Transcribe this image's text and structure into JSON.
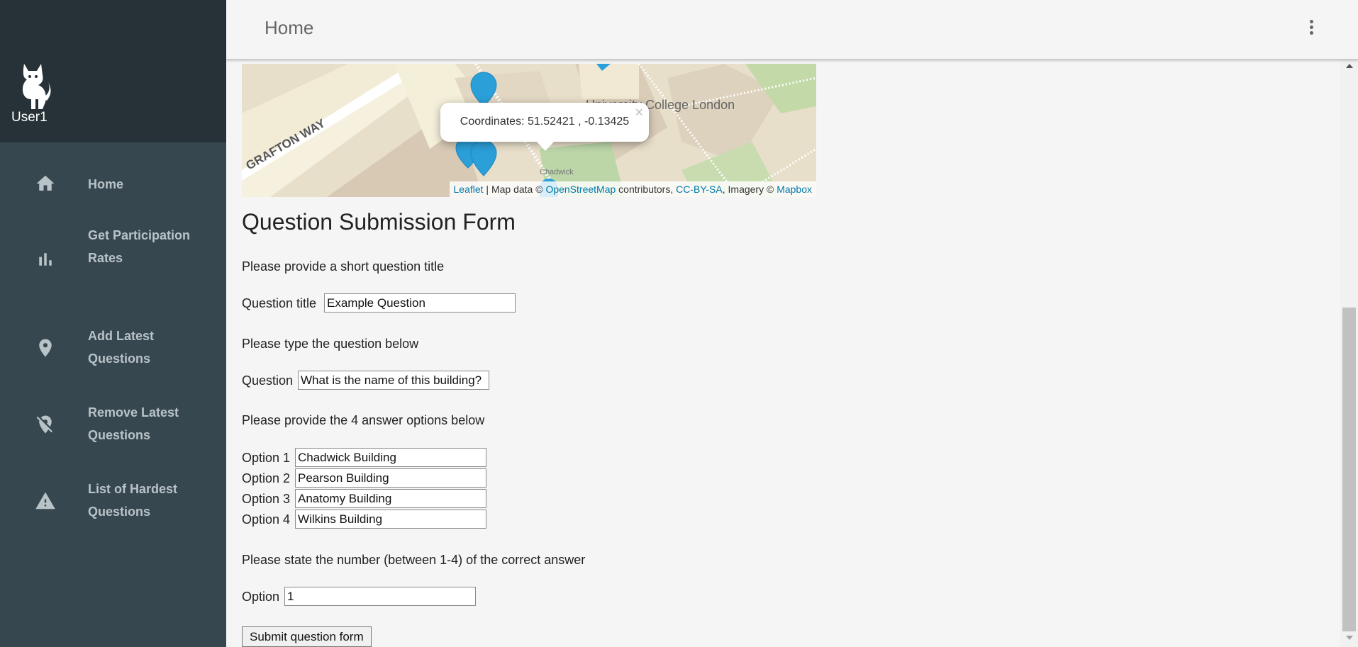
{
  "user": {
    "name": "User1",
    "avatar_icon": "cat-icon"
  },
  "topbar": {
    "title": "Home",
    "menu_icon": "more-vert-icon"
  },
  "sidebar": {
    "items": [
      {
        "label": "Home",
        "icon": "home-icon"
      },
      {
        "label": "Get Participation Rates",
        "icon": "bar-chart-icon"
      },
      {
        "label": "Add Latest Questions",
        "icon": "location-pin-icon"
      },
      {
        "label": "Remove Latest Questions",
        "icon": "location-off-icon"
      },
      {
        "label": "List of Hardest Questions",
        "icon": "warning-icon"
      }
    ]
  },
  "map": {
    "popup_text": "Coordinates: 51.52421 , -0.13425",
    "popup_close": "×",
    "street_label": "GRAFTON WAY",
    "building_label": "University College London",
    "small_label": "Chadwick",
    "attribution": {
      "leaflet": "Leaflet",
      "sep1": " | Map data © ",
      "osm": "OpenStreetMap",
      "contributors": " contributors, ",
      "license": "CC-BY-SA",
      "imagery": ", Imagery © ",
      "mapbox": "Mapbox"
    }
  },
  "form": {
    "heading": "Question Submission Form",
    "title_instruction": "Please provide a short question title",
    "title_label": "Question title",
    "title_value": "Example Question",
    "question_instruction": "Please type the question below",
    "question_label": "Question",
    "question_value": "What is the name of this building?",
    "options_instruction": "Please provide the 4 answer options below",
    "options": [
      {
        "label": "Option 1",
        "value": "Chadwick Building"
      },
      {
        "label": "Option 2",
        "value": "Pearson Building"
      },
      {
        "label": "Option 3",
        "value": "Anatomy Building"
      },
      {
        "label": "Option 4",
        "value": "Wilkins Building"
      }
    ],
    "correct_instruction": "Please state the number (between 1-4) of the correct answer",
    "correct_label": "Option",
    "correct_value": "1",
    "submit_label": "Submit question form"
  },
  "colors": {
    "sidebar_header": "#263238",
    "sidebar_body": "#37474f",
    "nav_text": "#b8c3c8",
    "marker": "#2b9fd8",
    "link": "#0078a8"
  }
}
